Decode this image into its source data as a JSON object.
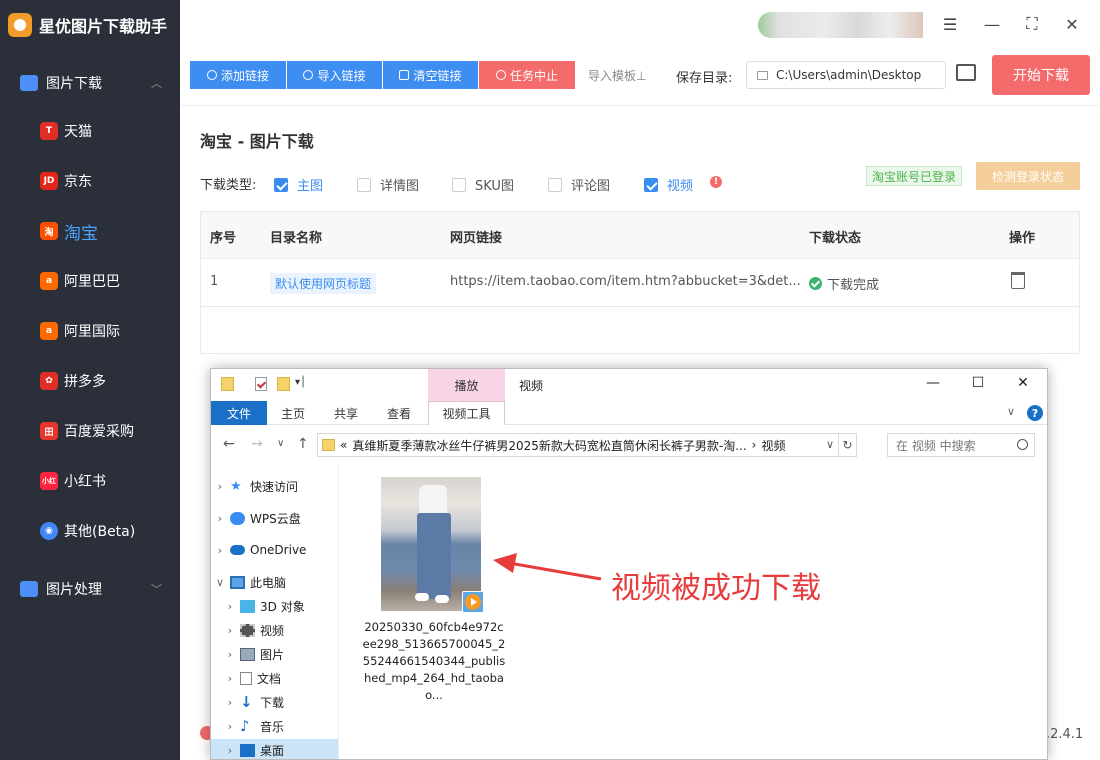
{
  "app": {
    "title": "星优图片下载助手",
    "version": ".2.4.1"
  },
  "sidebar": {
    "group1": "图片下载",
    "items": [
      {
        "label": "天猫",
        "icon": "tmall-icon",
        "color": "#e02e24",
        "glyph": "T"
      },
      {
        "label": "京东",
        "icon": "jd-icon",
        "color": "#e1251b",
        "glyph": "JD"
      },
      {
        "label": "淘宝",
        "icon": "taobao-icon",
        "color": "#ff5000",
        "glyph": "淘"
      },
      {
        "label": "阿里巴巴",
        "icon": "alibaba-icon",
        "color": "#ff6a00",
        "glyph": "a"
      },
      {
        "label": "阿里国际",
        "icon": "alibaba-intl-icon",
        "color": "#ff6a00",
        "glyph": "a"
      },
      {
        "label": "拼多多",
        "icon": "pinduoduo-icon",
        "color": "#e02e24",
        "glyph": "✿"
      },
      {
        "label": "百度爱采购",
        "icon": "baidu-icon",
        "color": "#e8352c",
        "glyph": "田"
      },
      {
        "label": "小红书",
        "icon": "xiaohongshu-icon",
        "color": "#ff2442",
        "glyph": "小红"
      },
      {
        "label": "其他(Beta)",
        "icon": "chrome-icon",
        "color": "#4285f4",
        "glyph": "◉"
      }
    ],
    "group2": "图片处理"
  },
  "toolbar": {
    "add_link": "添加链接",
    "import_link": "导入链接",
    "clear_link": "清空链接",
    "stop_task": "任务中止",
    "import_template": "导入模板⊥",
    "save_dir_label": "保存目录:",
    "save_dir_value": "C:\\Users\\admin\\Desktop",
    "start": "开始下载",
    "colors": {
      "blue": "#3d8ef0",
      "red": "#f36b6b"
    }
  },
  "panel": {
    "title": "淘宝 - 图片下载",
    "download_type_label": "下载类型:",
    "types": [
      {
        "label": "主图",
        "checked": true
      },
      {
        "label": "详情图",
        "checked": false
      },
      {
        "label": "SKU图",
        "checked": false
      },
      {
        "label": "评论图",
        "checked": false
      },
      {
        "label": "视频",
        "checked": true
      }
    ],
    "login_badge": "淘宝账号已登录",
    "check_login": "检测登录状态"
  },
  "table": {
    "headers": [
      "序号",
      "目录名称",
      "网页链接",
      "下载状态",
      "操作"
    ],
    "rows": [
      {
        "index": "1",
        "dir": "默认使用网页标题",
        "url": "https://item.taobao.com/item.htm?abbucket=3&det...",
        "status": "下载完成"
      }
    ]
  },
  "explorer": {
    "context_tab": "播放",
    "window_name": "视频",
    "ribbon": {
      "file": "文件",
      "home": "主页",
      "share": "共享",
      "view": "查看",
      "video_tools": "视频工具"
    },
    "address": {
      "prefix": "«",
      "folder": "真维斯夏季薄款冰丝牛仔裤男2025新款大码宽松直筒休闲长裤子男款-淘...",
      "sep": "›",
      "current": "视频"
    },
    "search_placeholder": "在 视频 中搜索",
    "tree": [
      {
        "label": "快速访问",
        "icon": "star-icon"
      },
      {
        "label": "WPS云盘",
        "icon": "cloud-icon"
      },
      {
        "label": "OneDrive",
        "icon": "onedrive-icon"
      },
      {
        "label": "此电脑",
        "icon": "pc-icon"
      },
      {
        "label": "3D 对象",
        "icon": "cube-icon"
      },
      {
        "label": "视频",
        "icon": "film-icon"
      },
      {
        "label": "图片",
        "icon": "image-icon"
      },
      {
        "label": "文档",
        "icon": "doc-icon"
      },
      {
        "label": "下载",
        "icon": "download-icon"
      },
      {
        "label": "音乐",
        "icon": "music-icon"
      },
      {
        "label": "桌面",
        "icon": "desktop-icon"
      }
    ],
    "file_name": "20250330_60fcb4e972cee298_513665700045_255244661540344_published_mp4_264_hd_taobao..."
  },
  "annotation": "视频被成功下载"
}
